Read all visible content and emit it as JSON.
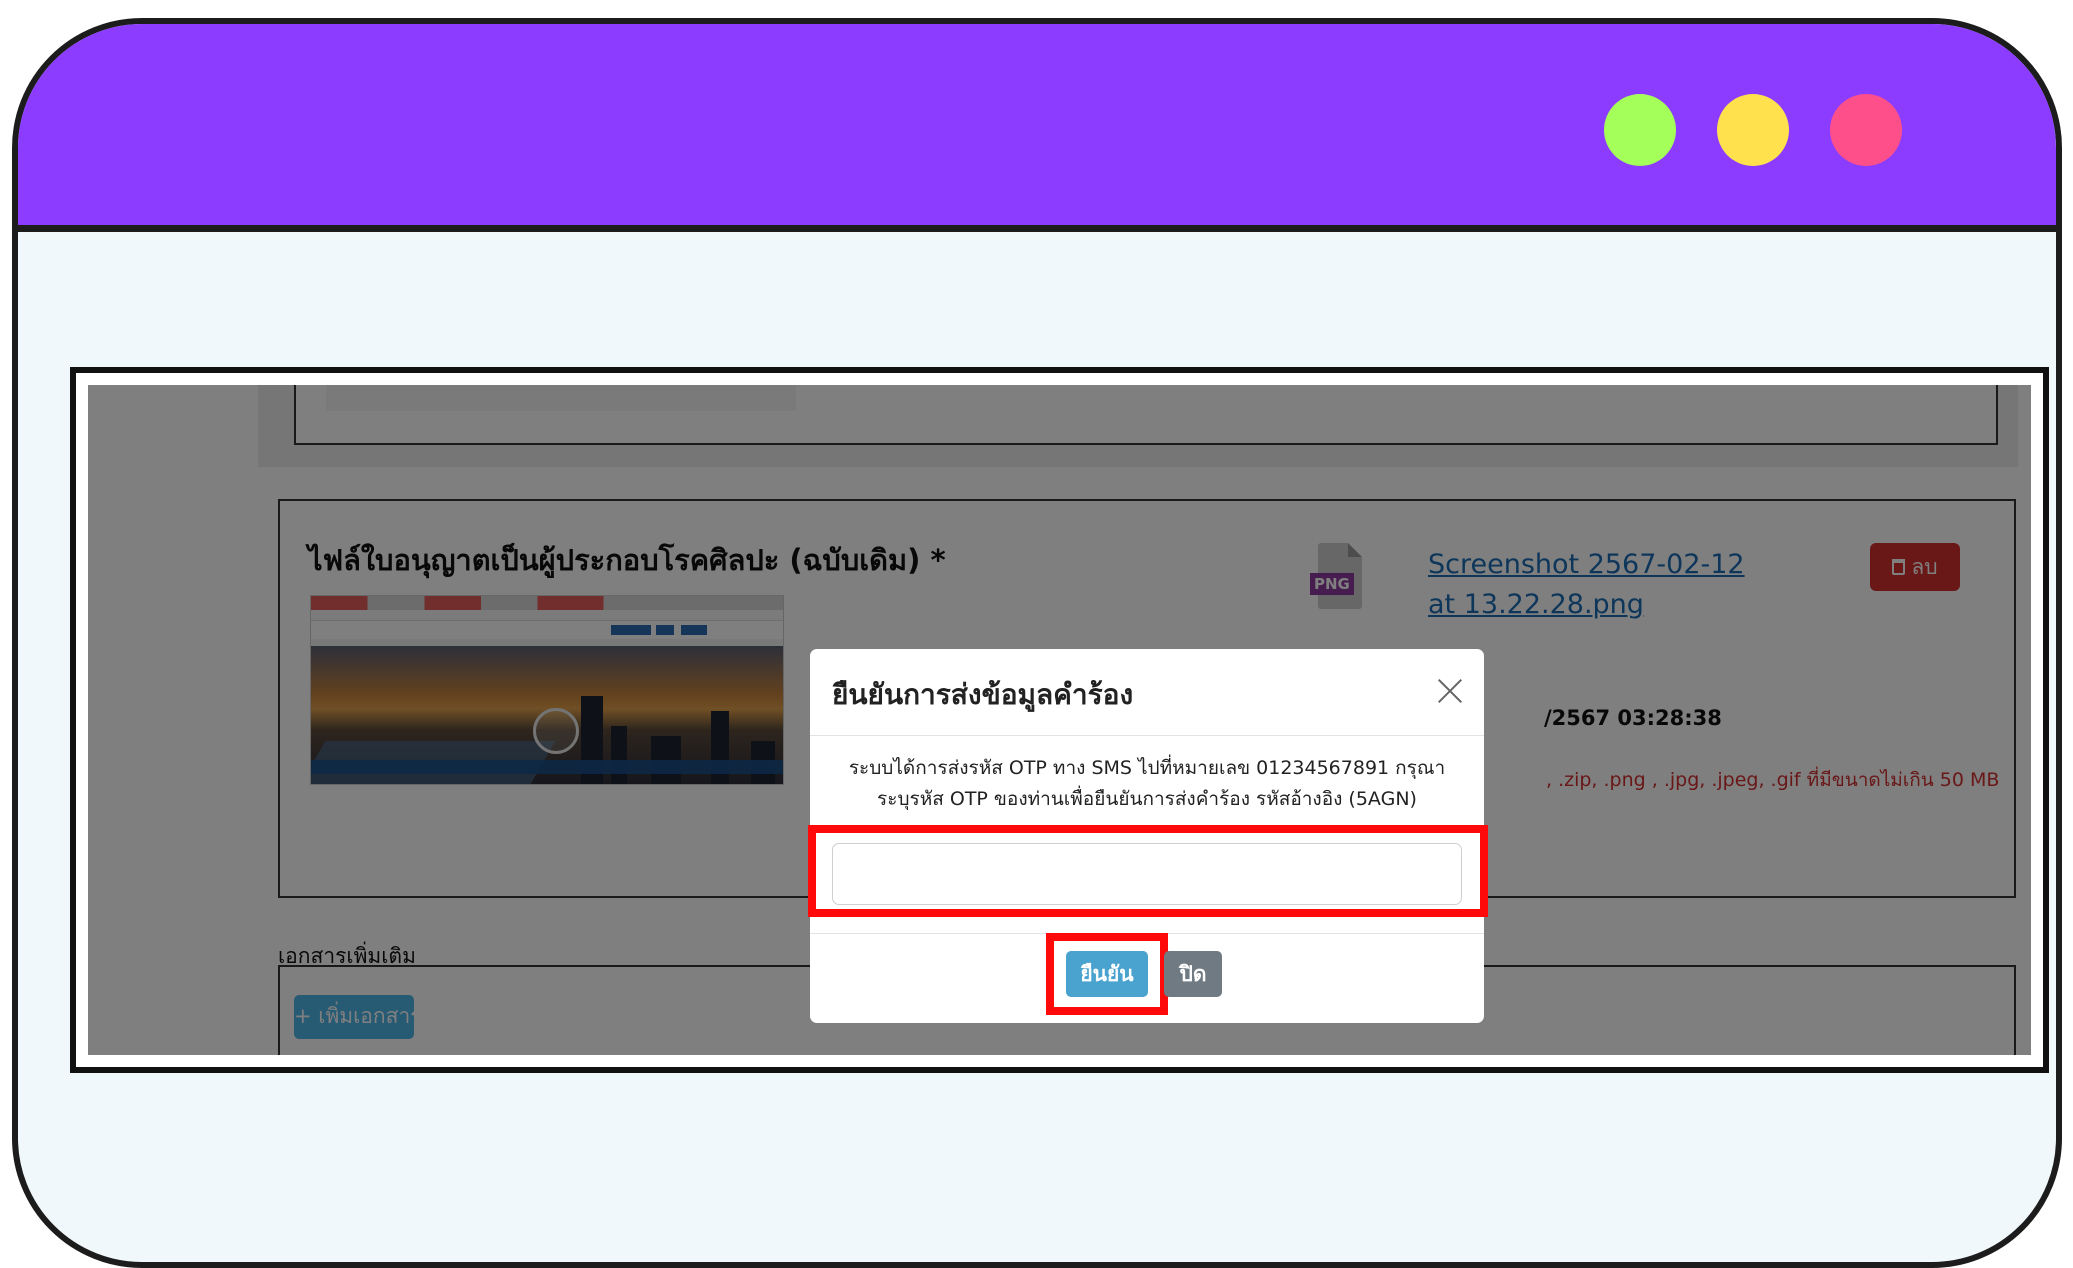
{
  "colors": {
    "titlebar": "#8b3cff",
    "window_body": "#f1f8fc",
    "dot_green": "#a5ff5a",
    "dot_yellow": "#ffe14d",
    "dot_pink": "#ff4f8b",
    "highlight": "#ff0a0a",
    "confirm_button": "#4aa3cf",
    "close_button": "#707a82",
    "delete_button": "#d2312f",
    "link": "#1a6db5",
    "hint_text": "#d32f2f"
  },
  "window": {
    "dots": [
      "green-dot",
      "yellow-dot",
      "pink-dot"
    ]
  },
  "form": {
    "license_file_title": "ไฟล์ใบอนุญาตเป็นผู้ประกอบโรคศิลปะ (ฉบับเดิม) *",
    "file_type_badge": "PNG",
    "file_name": "Screenshot 2567-02-12 at 13.22.28.png",
    "delete_label": "ลบ",
    "upload_datetime": "/2567 03:28:38",
    "file_hint": ", .zip, .png , .jpg, .jpeg, .gif ที่มีขนาดไม่เกิน 50 MB",
    "extra_docs_label": "เอกสารเพิ่มเติม",
    "add_doc_label": "+ เพิ่มเอกสาร"
  },
  "modal": {
    "title": "ยืนยันการส่งข้อมูลคำร้อง",
    "message_line1": "ระบบได้การส่งรหัส OTP ทาง SMS ไปที่หมายเลข 01234567891 กรุณา",
    "message_line2": "ระบุรหัส OTP ของท่านเพื่อยืนยันการส่งคำร้อง รหัสอ้างอิง (5AGN)",
    "otp_value": "",
    "otp_placeholder": "",
    "confirm_label": "ยืนยัน",
    "close_label": "ปิด"
  }
}
